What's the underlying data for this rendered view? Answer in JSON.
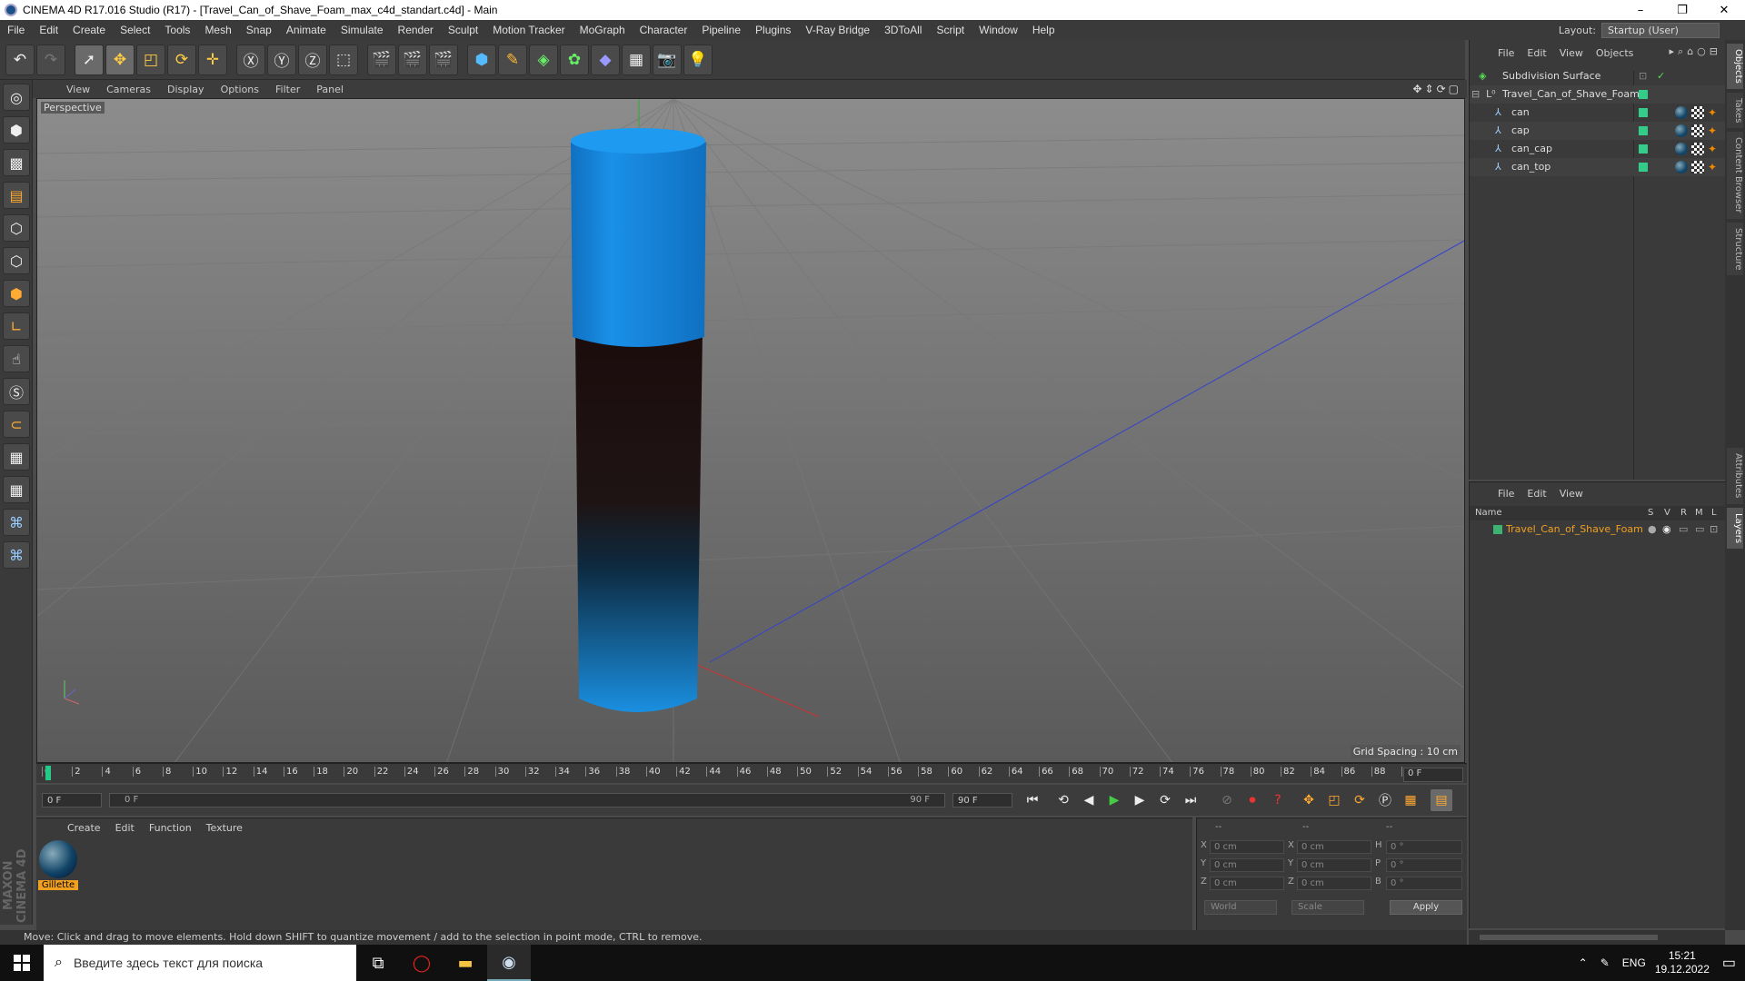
{
  "window": {
    "title": "CINEMA 4D R17.016 Studio (R17) - [Travel_Can_of_Shave_Foam_max_c4d_standart.c4d] - Main",
    "minimize": "–",
    "maximize": "❐",
    "close": "✕"
  },
  "menu": [
    "File",
    "Edit",
    "Create",
    "Select",
    "Tools",
    "Mesh",
    "Snap",
    "Animate",
    "Simulate",
    "Render",
    "Sculpt",
    "Motion Tracker",
    "MoGraph",
    "Character",
    "Pipeline",
    "Plugins",
    "V-Ray Bridge",
    "3DToAll",
    "Script",
    "Window",
    "Help"
  ],
  "layout": {
    "label": "Layout:",
    "value": "Startup (User)"
  },
  "viewport": {
    "menu": [
      "View",
      "Cameras",
      "Display",
      "Options",
      "Filter",
      "Panel"
    ],
    "label": "Perspective",
    "grid_spacing": "Grid Spacing : 10 cm"
  },
  "timeline": {
    "ticks": [
      "0",
      "2",
      "4",
      "6",
      "8",
      "10",
      "12",
      "14",
      "16",
      "18",
      "20",
      "22",
      "24",
      "26",
      "28",
      "30",
      "32",
      "34",
      "36",
      "38",
      "40",
      "42",
      "44",
      "46",
      "48",
      "50",
      "52",
      "54",
      "56",
      "58",
      "60",
      "62",
      "64",
      "66",
      "68",
      "70",
      "72",
      "74",
      "76",
      "78",
      "80",
      "82",
      "84",
      "86",
      "88",
      "90"
    ],
    "current_frame": "0 F"
  },
  "transport": {
    "start_field": "0 F",
    "range_start": "0 F",
    "range_end": "90 F",
    "end_field": "90 F"
  },
  "materials": {
    "menu": [
      "Create",
      "Edit",
      "Function",
      "Texture"
    ],
    "items": [
      {
        "name": "Gillette"
      }
    ]
  },
  "coords": {
    "header": [
      "--",
      "--",
      "--"
    ],
    "rows": [
      {
        "a": "X",
        "av": "0 cm",
        "b": "X",
        "bv": "0 cm",
        "c": "H",
        "cv": "0 °"
      },
      {
        "a": "Y",
        "av": "0 cm",
        "b": "Y",
        "bv": "0 cm",
        "c": "P",
        "cv": "0 °"
      },
      {
        "a": "Z",
        "av": "0 cm",
        "b": "Z",
        "bv": "0 cm",
        "c": "B",
        "cv": "0 °"
      }
    ],
    "mode1": "World",
    "mode2": "Scale",
    "apply": "Apply"
  },
  "status": "Move: Click and drag to move elements. Hold down SHIFT to quantize movement / add to the selection in point mode, CTRL to remove.",
  "objects": {
    "menu": [
      "File",
      "Edit",
      "View",
      "Objects"
    ],
    "items": [
      {
        "name": "Subdivision Surface"
      },
      {
        "name": "Travel_Can_of_Shave_Foam"
      },
      {
        "name": "can"
      },
      {
        "name": "cap"
      },
      {
        "name": "can_cap"
      },
      {
        "name": "can_top"
      }
    ]
  },
  "layers": {
    "menu": [
      "File",
      "Edit",
      "View"
    ],
    "columns": {
      "name": "Name",
      "s": "S",
      "v": "V",
      "r": "R",
      "m": "M",
      "l": "L"
    },
    "items": [
      {
        "name": "Travel_Can_of_Shave_Foam",
        "color": "#3cb371"
      }
    ]
  },
  "side_tabs": [
    "Objects",
    "Takes",
    "Content Browser",
    "Structure",
    "Attributes",
    "Layers"
  ],
  "maxon": "MAXON CINEMA 4D",
  "taskbar": {
    "search_placeholder": "Введите здесь текст для поиска",
    "lang": "ENG",
    "time": "15:21",
    "date": "19.12.2022"
  },
  "colors": {
    "can_blue": "#1a8fe0",
    "can_dark": "#1a0d0d",
    "accent_orange": "#f0a020"
  }
}
